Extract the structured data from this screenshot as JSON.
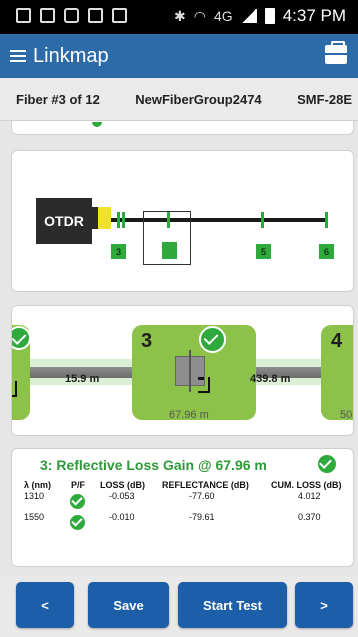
{
  "status_bar": {
    "time": "4:37 PM",
    "network": "4G"
  },
  "app_bar": {
    "title": "Linkmap",
    "menu_icon": "hamburger-menu-icon",
    "tools_icon": "toolbox-icon"
  },
  "info_bar": {
    "fiber": "Fiber #3 of 12",
    "group": "NewFiberGroup2474",
    "fiber_type": "SMF-28E"
  },
  "link_map": {
    "source_label": "OTDR",
    "event_tags": [
      "3",
      "5",
      "6"
    ]
  },
  "event_strip": {
    "events": [
      {
        "number": "3",
        "position": "67.96 m"
      },
      {
        "number": "4",
        "position": "50"
      }
    ],
    "distances": [
      "15.9 m",
      "439.8 m"
    ]
  },
  "detail": {
    "title": "3: Reflective Loss Gain @ 67.96 m",
    "columns": [
      "λ (nm)",
      "P/F",
      "LOSS (dB)",
      "REFLECTANCE (dB)",
      "CUM. LOSS (dB)"
    ],
    "rows": [
      {
        "wavelength": "1310",
        "loss": "-0.053",
        "reflectance": "-77.60",
        "cum_loss": "4.012"
      },
      {
        "wavelength": "1550",
        "loss": "-0.010",
        "reflectance": "-79.61",
        "cum_loss": "0.370"
      }
    ]
  },
  "buttons": {
    "prev": "<",
    "save": "Save",
    "start": "Start Test",
    "next": ">"
  },
  "colors": {
    "app_bar": "#2d6aa8",
    "button": "#1c5ea8",
    "pass_green": "#2eaa3c",
    "event_green": "#8cc24a"
  }
}
